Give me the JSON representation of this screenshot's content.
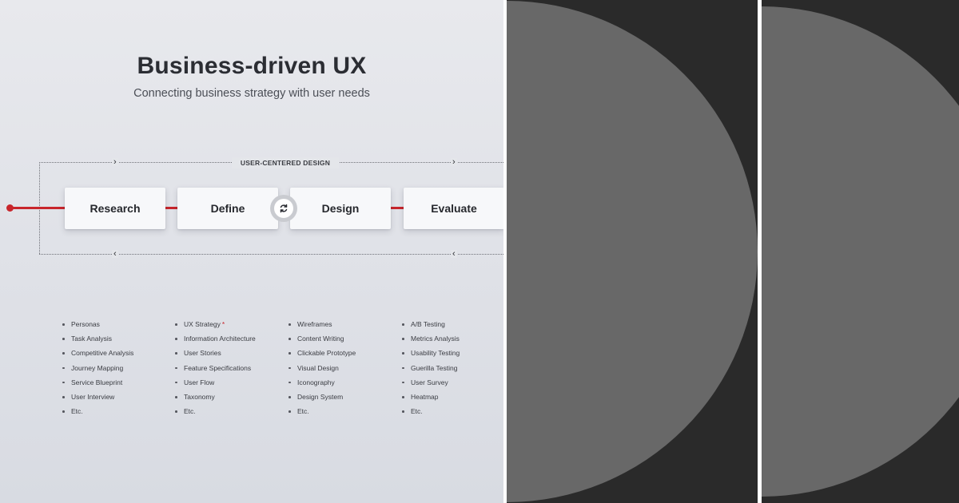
{
  "header": {
    "title": "Business-driven UX",
    "subtitle": "Connecting business strategy with user needs"
  },
  "flow": {
    "label": "USER-CENTERED DESIGN",
    "stages": [
      "Research",
      "Define",
      "Design",
      "Evaluate"
    ],
    "loop_icon": "refresh-icon",
    "accent_color": "#c8252b"
  },
  "columns": [
    {
      "items": [
        "Personas",
        "Task Analysis",
        "Competitive Analysis",
        "Journey Mapping",
        "Service Blueprint",
        "User Interview",
        "Etc."
      ]
    },
    {
      "items": [
        "UX Strategy",
        "Information Architecture",
        "User Stories",
        "Feature Specifications",
        "User Flow",
        "Taxonomy",
        "Etc."
      ],
      "marker": "*"
    },
    {
      "items": [
        "Wireframes",
        "Content Writing",
        "Clickable Prototype",
        "Visual Design",
        "Iconography",
        "Design System",
        "Etc."
      ]
    },
    {
      "items": [
        "A/B Testing",
        "Metrics Analysis",
        "Usability Testing",
        "Guerilla Testing",
        "User Survey",
        "Heatmap",
        "Etc."
      ]
    }
  ],
  "colors": {
    "panel_bg": "#e4e6ea",
    "dark_bg": "#2a2a2a",
    "circle": "#686868"
  }
}
